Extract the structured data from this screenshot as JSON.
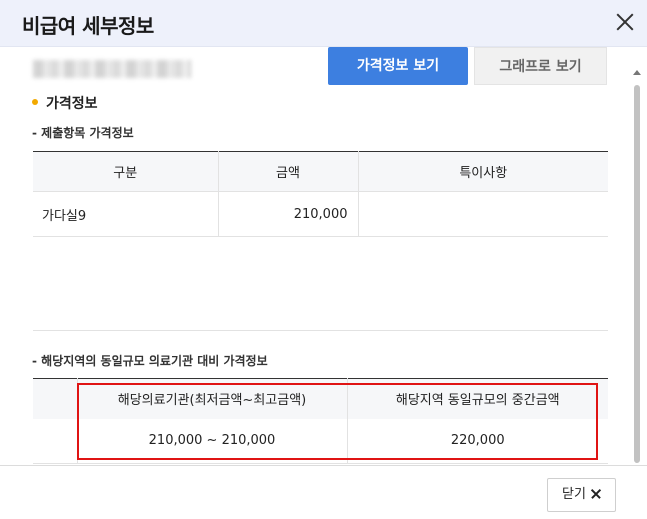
{
  "modal": {
    "title": "비급여 세부정보"
  },
  "view_buttons": {
    "price_view": "가격정보 보기",
    "graph_view": "그래프로 보기"
  },
  "price_section": {
    "title": "가격정보",
    "submitted_label": "- 제출항목 가격정보",
    "submitted_headers": [
      "구분",
      "금액",
      "특이사항"
    ],
    "submitted_rows": [
      [
        "가다실9",
        "210,000",
        ""
      ]
    ],
    "regional_label": "- 해당지역의 동일규모 의료기관 대비 가격정보",
    "regional_headers": [
      "해당의료기관(최저금액~최고금액)",
      "해당지역 동일규모의 중간금액"
    ],
    "regional_rows": [
      [
        "210,000 ~ 210,000",
        "220,000"
      ]
    ]
  },
  "footer": {
    "close_label": "닫기"
  },
  "colors": {
    "primary_button": "#3d7fe0",
    "highlight_border": "#e01414",
    "bullet": "#f2a900"
  }
}
